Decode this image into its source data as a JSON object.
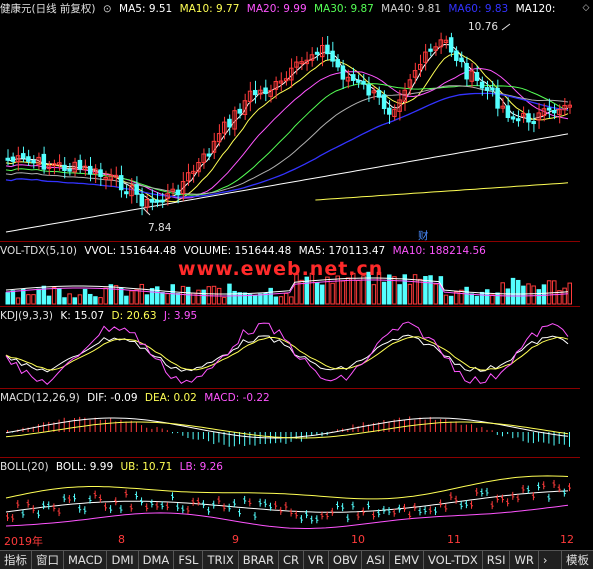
{
  "main": {
    "title": "健康元(日线 前复权)",
    "ma": [
      {
        "label": "MA5: 9.51",
        "color": "#ffffff"
      },
      {
        "label": "MA10: 9.77",
        "color": "#ffff55"
      },
      {
        "label": "MA20: 9.99",
        "color": "#ff55ff"
      },
      {
        "label": "MA30: 9.87",
        "color": "#55ff55"
      },
      {
        "label": "MA40: 9.81",
        "color": "#d0d0d0"
      },
      {
        "label": "MA60: 9.83",
        "color": "#3333ff"
      },
      {
        "label": "MA120:",
        "color": "#ffffff"
      }
    ],
    "high_label": "10.76",
    "low_label": "7.84",
    "cai_label": "财"
  },
  "vol": {
    "title": "VOL-TDX(5,10)",
    "items": [
      {
        "label": "VVOL: 151644.48",
        "color": "#ffffff"
      },
      {
        "label": "VOLUME: 151644.48",
        "color": "#ffffff"
      },
      {
        "label": "MA5: 170113.47",
        "color": "#ffffff"
      },
      {
        "label": "MA10: 188214.56",
        "color": "#ff55ff"
      }
    ]
  },
  "kdj": {
    "title": "KDJ(9,3,3)",
    "items": [
      {
        "label": "K: 15.07",
        "color": "#ffffff"
      },
      {
        "label": "D: 20.63",
        "color": "#ffff55"
      },
      {
        "label": "J: 3.95",
        "color": "#ff55ff"
      }
    ]
  },
  "macd": {
    "title": "MACD(12,26,9)",
    "items": [
      {
        "label": "DIF: -0.09",
        "color": "#ffffff"
      },
      {
        "label": "DEA: 0.02",
        "color": "#ffff55"
      },
      {
        "label": "MACD: -0.22",
        "color": "#ff55ff"
      }
    ]
  },
  "boll": {
    "title": "BOLL(20)",
    "items": [
      {
        "label": "BOLL: 9.99",
        "color": "#ffffff"
      },
      {
        "label": "UB: 10.71",
        "color": "#ffff55"
      },
      {
        "label": "LB: 9.26",
        "color": "#ff55ff"
      }
    ]
  },
  "watermark": "www.eweb.net.cn",
  "xaxis": [
    "2019年",
    "8",
    "9",
    "10",
    "11",
    "12"
  ],
  "tabs": [
    "指标",
    "窗口",
    "MACD",
    "DMI",
    "DMA",
    "FSL",
    "TRIX",
    "BRAR",
    "CR",
    "VR",
    "OBV",
    "ASI",
    "EMV",
    "VOL-TDX",
    "RSI",
    "WR"
  ],
  "tab_arrow": "›",
  "tab_right": "模板",
  "scroll_icon": "◇"
}
